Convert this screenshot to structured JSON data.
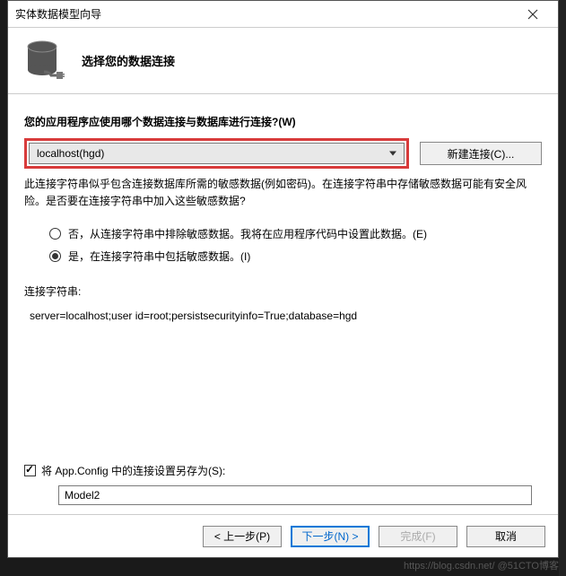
{
  "titlebar": {
    "title": "实体数据模型向导"
  },
  "header": {
    "subtitle": "选择您的数据连接"
  },
  "content": {
    "question": "您的应用程序应使用哪个数据连接与数据库进行连接?(W)",
    "selected_connection": "localhost(hgd)",
    "new_connection_label": "新建连接(C)...",
    "warning_line": "此连接字符串似乎包含连接数据库所需的敏感数据(例如密码)。在连接字符串中存储敏感数据可能有安全风险。是否要在连接字符串中加入这些敏感数据?",
    "radio_no": "否，从连接字符串中排除敏感数据。我将在应用程序代码中设置此数据。(E)",
    "radio_yes": "是，在连接字符串中包括敏感数据。(I)",
    "cs_label": "连接字符串:",
    "cs_value": "server=localhost;user id=root;persistsecurityinfo=True;database=hgd",
    "save_checkbox_label": "将 App.Config 中的连接设置另存为(S):",
    "model_name": "Model2"
  },
  "footer": {
    "prev": "< 上一步(P)",
    "next": "下一步(N) >",
    "finish": "完成(F)",
    "cancel": "取消"
  },
  "watermark": "https://blog.csdn.net/ @51CTO博客"
}
